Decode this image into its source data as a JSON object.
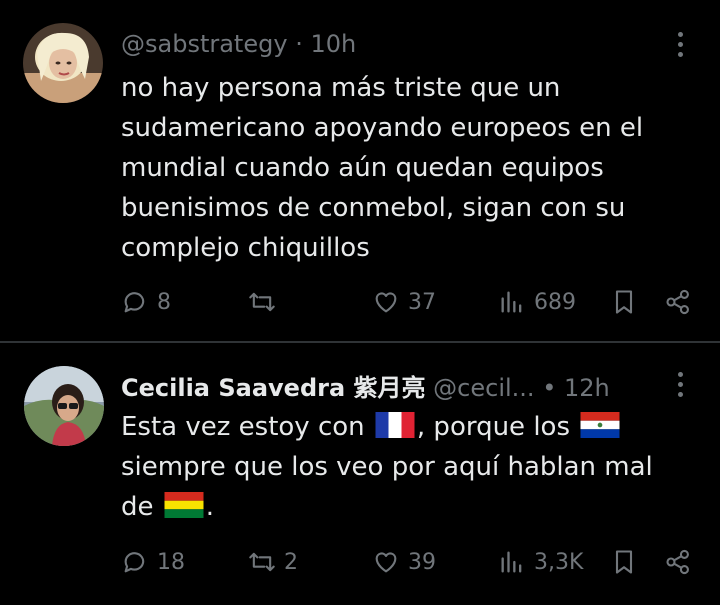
{
  "tweets": [
    {
      "handle": "@sabstrategy",
      "separator": "·",
      "time": "10h",
      "text_lines": [
        "no hay persona más triste que un",
        "sudamericano apoyando europeos en el",
        "mundial cuando aún quedan equipos",
        "buenisimos de conmebol, sigan con su",
        "complejo chiquillos"
      ],
      "replies": "8",
      "retweets": "",
      "likes": "37",
      "views": "689"
    },
    {
      "name": "Cecilia Saavedra 紫月亮",
      "handle": "@cecil...",
      "separator": "•",
      "time": "12h",
      "text_line1_a": "Esta vez estoy con",
      "text_line1_b": ", porque los",
      "text_line2": "siempre que los veo por aquí hablan mal",
      "text_line3_a": "de",
      "text_line3_b": ".",
      "replies": "18",
      "retweets": "2",
      "likes": "39",
      "views": "3,3K"
    }
  ],
  "icons": {
    "reply": "reply-icon",
    "retweet": "retweet-icon",
    "like": "heart-icon",
    "views": "views-icon",
    "bookmark": "bookmark-icon",
    "share": "share-icon",
    "more": "more-icon",
    "flags": [
      "flag-france-icon",
      "flag-paraguay-icon",
      "flag-bolivia-icon"
    ]
  },
  "colors": {
    "background": "#000000",
    "text": "#e7e9ea",
    "muted": "#71767b",
    "divider": "#2f3336"
  }
}
